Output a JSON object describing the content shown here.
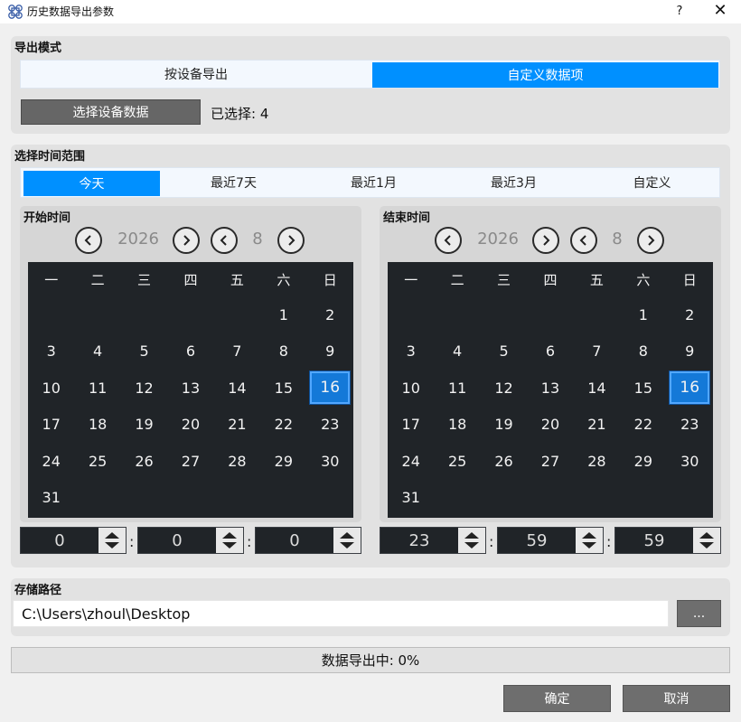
{
  "window": {
    "title": "历史数据导出参数",
    "help_label": "?",
    "close_label": "✕"
  },
  "export_mode": {
    "label": "导出模式",
    "options": [
      "按设备导出",
      "自定义数据项"
    ],
    "selected_index": 1,
    "select_button": "选择设备数据",
    "selected_count_text": "已选择: 4"
  },
  "time_range": {
    "label": "选择时间范围",
    "options": [
      "今天",
      "最近7天",
      "最近1月",
      "最近3月",
      "自定义"
    ],
    "selected_index": 0
  },
  "calendars": {
    "weekdays": [
      "一",
      "二",
      "三",
      "四",
      "五",
      "六",
      "日"
    ],
    "start": {
      "label": "开始时间",
      "year": "2026",
      "month": "8",
      "selected_day": "16",
      "hour": "0",
      "minute": "0",
      "second": "0"
    },
    "end": {
      "label": "结束时间",
      "year": "2026",
      "month": "8",
      "selected_day": "16",
      "hour": "23",
      "minute": "59",
      "second": "59"
    },
    "rows": [
      [
        "",
        "",
        "",
        "",
        "",
        "1",
        "2"
      ],
      [
        "3",
        "4",
        "5",
        "6",
        "7",
        "8",
        "9"
      ],
      [
        "10",
        "11",
        "12",
        "13",
        "14",
        "15",
        "16"
      ],
      [
        "17",
        "18",
        "19",
        "20",
        "21",
        "22",
        "23"
      ],
      [
        "24",
        "25",
        "26",
        "27",
        "28",
        "29",
        "30"
      ],
      [
        "31",
        "",
        "",
        "",
        "",
        "",
        ""
      ]
    ]
  },
  "storage": {
    "label": "存储路径",
    "path": "C:\\Users\\zhoul\\Desktop",
    "browse_label": "..."
  },
  "status": {
    "progress_text": "数据导出中: 0%"
  },
  "footer": {
    "ok_label": "确定",
    "cancel_label": "取消"
  },
  "colors": {
    "accent": "#0090ff",
    "calendar_bg": "#202428",
    "selected_day": "#1479d8"
  }
}
